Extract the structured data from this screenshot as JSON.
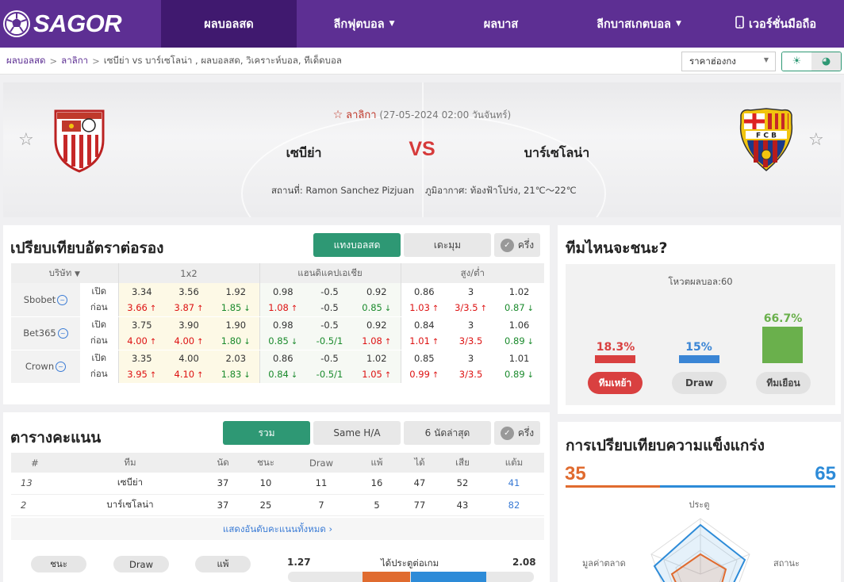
{
  "nav": {
    "logo_text": "SAGOR",
    "items": [
      "ผลบอลสด",
      "ลีกฟุตบอล",
      "ผลบาส",
      "ลีกบาสเกตบอล",
      "เวอร์ชั่นมือถือ"
    ]
  },
  "breadcrumb": {
    "home": "ผลบอลสด",
    "league": "ลาลิกา",
    "current": "เซบีย่า vs  บาร์เซโลน่า ,  ผลบอลสด,  วิเคราะห์บอล,  ทีเด็ดบอล"
  },
  "odds_type": {
    "selected": "ราคาฮ่องกง"
  },
  "match": {
    "league": "ลาลิกา",
    "datetime": "(27-05-2024 02:00 วันจันทร์)",
    "home": "เซบีย่า",
    "away": "บาร์เซโลน่า",
    "vs": "VS",
    "venue": "สถานที่: Ramon Sanchez Pizjuan",
    "weather": "ภูมิอากาศ: ท้องฟ้าโปร่ง, 21℃～22℃"
  },
  "odds": {
    "title": "เปรียบเทียบอัตราต่อรอง",
    "tabs": [
      "แทงบอลสด",
      "เดะมุม",
      "ครึ่ง"
    ],
    "headers": {
      "company": "บริษัท",
      "x12": "1x2",
      "handicap": "แฮนดิแคปเอเชีย",
      "ou": "สูง/ต่ำ"
    },
    "open_label": "เปิด",
    "before_label": "ก่อน",
    "rows": [
      {
        "bookmaker": "Sbobet",
        "open": [
          "3.34",
          "3.56",
          "1.92",
          "0.98",
          "-0.5",
          "0.92",
          "0.86",
          "3",
          "1.02"
        ],
        "before": [
          "3.66",
          "3.87",
          "1.85",
          "1.08",
          "-0.5",
          "0.85",
          "1.03",
          "3/3.5",
          "0.87"
        ],
        "dirs": [
          "up",
          "up",
          "down",
          "up",
          "",
          "down",
          "up",
          "up",
          "down"
        ]
      },
      {
        "bookmaker": "Bet365",
        "open": [
          "3.75",
          "3.90",
          "1.90",
          "0.98",
          "-0.5",
          "0.92",
          "0.84",
          "3",
          "1.06"
        ],
        "before": [
          "4.00",
          "4.00",
          "1.80",
          "0.85",
          "-0.5/1",
          "1.08",
          "1.01",
          "3/3.5",
          "0.89"
        ],
        "dirs": [
          "up",
          "up",
          "down",
          "down",
          "g",
          "up",
          "up",
          "r",
          "down"
        ]
      },
      {
        "bookmaker": "Crown",
        "open": [
          "3.35",
          "4.00",
          "2.03",
          "0.86",
          "-0.5",
          "1.02",
          "0.85",
          "3",
          "1.01"
        ],
        "before": [
          "3.95",
          "4.10",
          "1.83",
          "0.84",
          "-0.5/1",
          "1.05",
          "0.99",
          "3/3.5",
          "0.89"
        ],
        "dirs": [
          "up",
          "up",
          "down",
          "down",
          "g",
          "up",
          "up",
          "r",
          "down"
        ]
      }
    ]
  },
  "standings": {
    "title": "ตารางคะแนน",
    "tabs": [
      "รวม",
      "Same H/A",
      "6 นัดล่าสุด",
      "ครึ่ง"
    ],
    "headers": [
      "#",
      "ทีม",
      "นัด",
      "ชนะ",
      "Draw",
      "แพ้",
      "ได้",
      "เสีย",
      "แต้ม"
    ],
    "rows": [
      [
        "13",
        "เซบีย่า",
        "37",
        "10",
        "11",
        "16",
        "47",
        "52",
        "41"
      ],
      [
        "2",
        "บาร์เซโลน่า",
        "37",
        "25",
        "7",
        "5",
        "77",
        "43",
        "82"
      ]
    ],
    "show_all": "แสดงอันดับคะแนนทั้งหมด"
  },
  "stats_row": {
    "pills": [
      "ชนะ",
      "Draw",
      "แพ้"
    ],
    "home_goals": "1.27",
    "label": "ได้ประตูต่อเกม",
    "away_goals": "2.08",
    "home_share": 0.38
  },
  "who_wins": {
    "title": "ทีมไหนจะชนะ?",
    "votes": "โหวตผลบอล:60",
    "home_pct": "18.3%",
    "draw_pct": "15%",
    "away_pct": "66.7%",
    "home_value": 18.3,
    "draw_value": 15,
    "away_value": 66.7,
    "buttons": [
      "ทีมเหย้า",
      "Draw",
      "ทีมเยือน"
    ],
    "colors": {
      "home": "#d94040",
      "draw": "#3a85d5",
      "away": "#6ab04c"
    }
  },
  "strength": {
    "title": "การเปรียบเทียบความแข็งแกร่ง",
    "home": "35",
    "away": "65",
    "home_value": 35,
    "away_value": 65,
    "axes": [
      "ประตู",
      "สถานะ",
      "มูลค่าตลาด"
    ]
  }
}
